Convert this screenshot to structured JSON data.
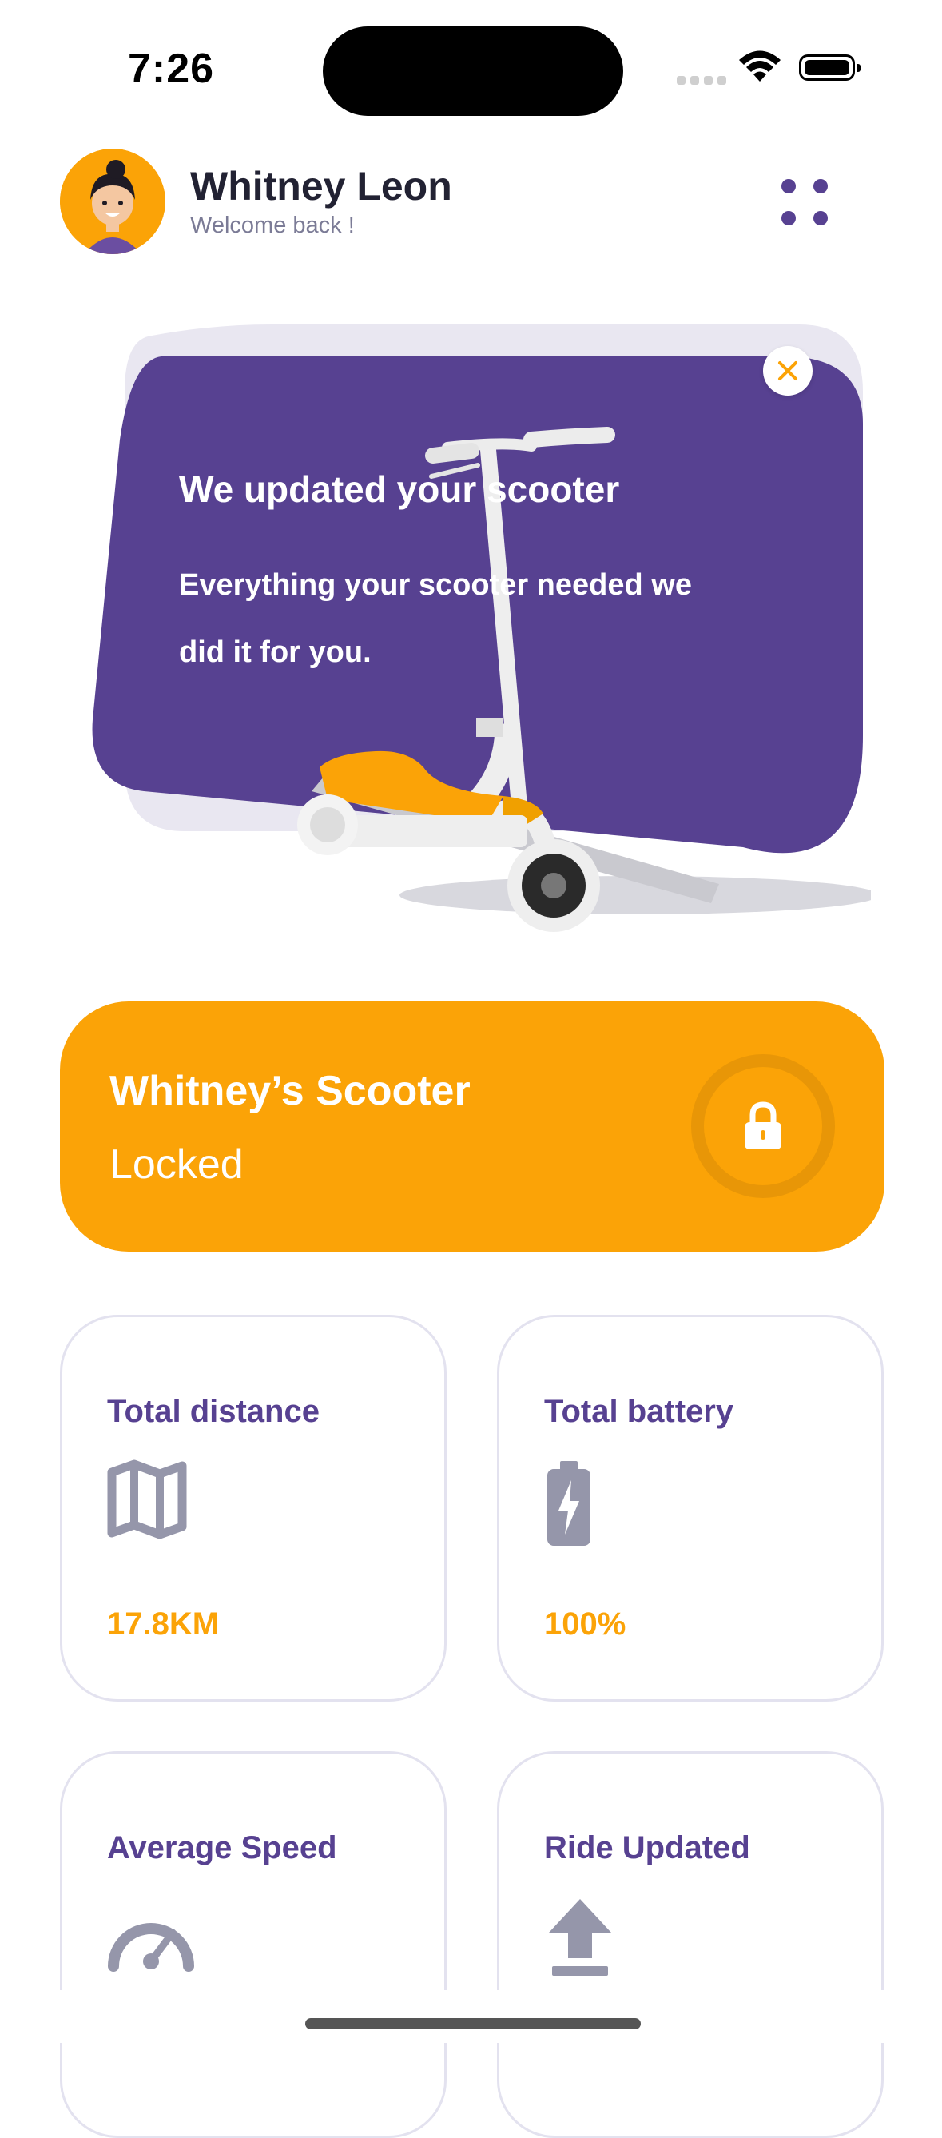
{
  "status_bar": {
    "time": "7:26"
  },
  "header": {
    "user_name": "Whitney Leon",
    "greeting": "Welcome back !"
  },
  "banner": {
    "title": "We updated your scooter",
    "body": "Everything your scooter needed we did it for you."
  },
  "scooter": {
    "name": "Whitney’s Scooter",
    "status": "Locked"
  },
  "stats": [
    {
      "title": "Total distance",
      "value": "17.8KM",
      "icon": "map-icon"
    },
    {
      "title": "Total battery",
      "value": "100%",
      "icon": "battery-charging-icon"
    },
    {
      "title": "Average Speed",
      "value": "",
      "icon": "speedometer-icon"
    },
    {
      "title": "Ride Updated",
      "value": "",
      "icon": "upload-icon"
    }
  ],
  "colors": {
    "accent": "#fba307",
    "brand_purple": "#574191",
    "text_primary": "#222233",
    "text_secondary": "#7b7b96",
    "card_border": "#e3e2ef"
  }
}
